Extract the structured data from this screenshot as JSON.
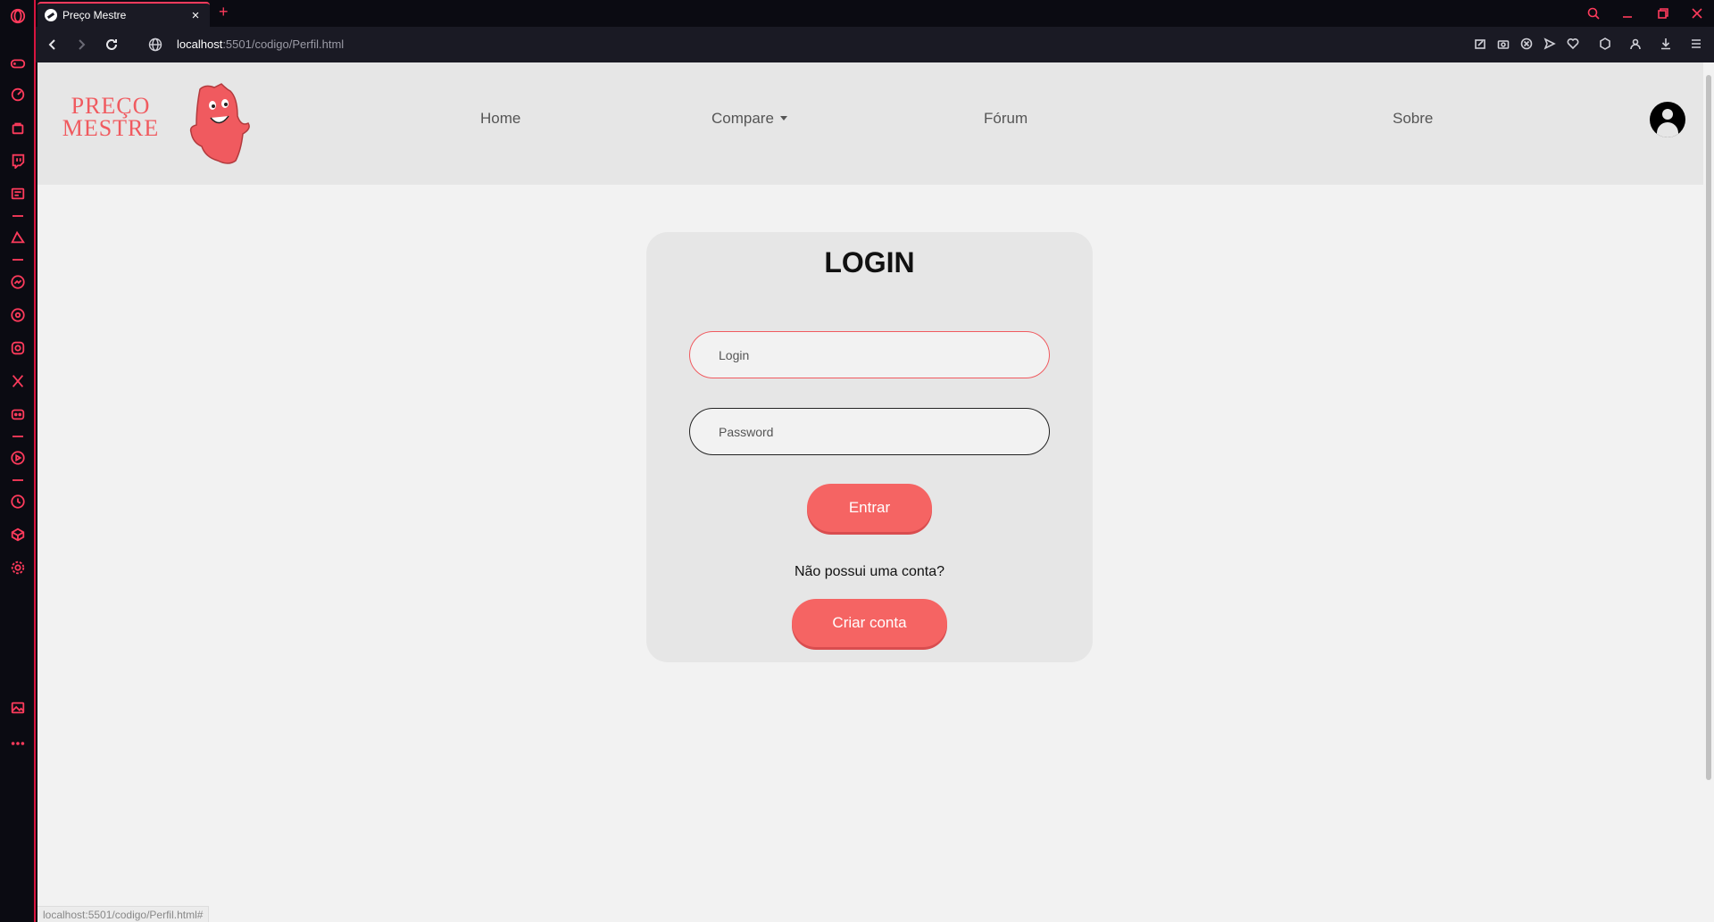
{
  "browser": {
    "tab_title": "Preço Mestre",
    "tab_close": "×",
    "new_tab": "+",
    "url_host": "localhost",
    "url_path": ":5501/codigo/Perfil.html",
    "status_url": "localhost:5501/codigo/Perfil.html#"
  },
  "sidebar": {
    "icons": [
      "gamepad-icon",
      "speed-dial-icon",
      "shopping-bag-icon",
      "twitch-icon",
      "news-icon",
      "aria-icon",
      "messenger-icon",
      "whatsapp-icon",
      "instagram-icon",
      "x-icon",
      "discord-icon",
      "player-icon",
      "history-icon",
      "extensions-icon",
      "settings-icon",
      "gallery-icon",
      "more-icon"
    ],
    "accent": "#ff3b5c"
  },
  "site": {
    "logo_line1": "PREÇO",
    "logo_line2": "MESTRE",
    "nav": {
      "home": "Home",
      "compare": "Compare",
      "forum": "Fórum",
      "about": "Sobre"
    },
    "brand_color": "#f56463"
  },
  "login": {
    "title": "LOGIN",
    "login_placeholder": "Login",
    "password_placeholder": "Password",
    "submit_label": "Entrar",
    "no_account_text": "Não possui uma conta?",
    "create_account_label": "Criar conta"
  }
}
